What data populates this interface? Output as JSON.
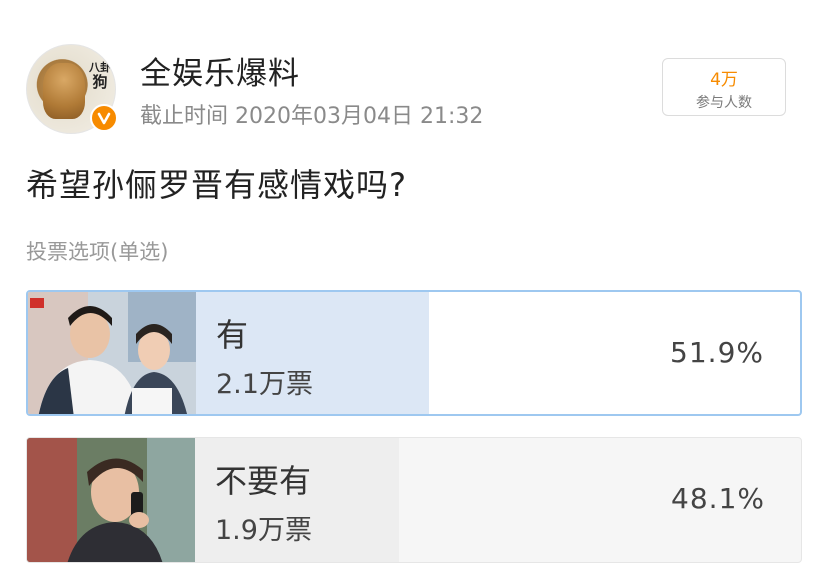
{
  "poll": {
    "author": "全娱乐爆料",
    "avatar_text": [
      "八卦",
      "狗"
    ],
    "deadline": "截止时间 2020年03月04日 21:32",
    "participants": {
      "value": "4万",
      "label": "参与人数"
    },
    "question": "希望孙俪罗晋有感情戏吗?",
    "vote_type": "投票选项(单选)",
    "options": [
      {
        "label": "有",
        "votes": "2.1万票",
        "percent": "51.9%",
        "fraction": 0.519,
        "selected": true
      },
      {
        "label": "不要有",
        "votes": "1.9万票",
        "percent": "48.1%",
        "fraction": 0.481,
        "selected": false
      }
    ]
  },
  "colors": {
    "accent_orange": "#f78b00",
    "selected_border": "#9ec8f0",
    "selected_fill": "#dce7f5",
    "unselected_fill": "#eeeeee"
  },
  "icons": {
    "verified": "verified-v-icon"
  }
}
